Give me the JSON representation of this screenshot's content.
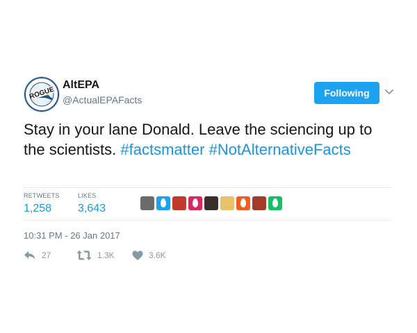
{
  "user": {
    "name": "AltEPA",
    "handle": "@ActualEPAFacts",
    "avatar_icon": "rogue-epa-logo"
  },
  "follow_button": {
    "label": "Following"
  },
  "menu_icon": "chevron-down-icon",
  "tweet": {
    "text_plain": "Stay in your lane Donald. Leave the sciencing up to the scientists.",
    "hashtags": [
      "#factsmatter",
      "#NotAlternativeFacts"
    ]
  },
  "stats": {
    "retweets_label": "RETWEETS",
    "retweets_value": "1,258",
    "likes_label": "LIKES",
    "likes_value": "3,643"
  },
  "likers": [
    {
      "type": "photo",
      "color": "#6b6b6b"
    },
    {
      "type": "egg",
      "color": "#1da1f2"
    },
    {
      "type": "photo",
      "color": "#c0392b"
    },
    {
      "type": "egg",
      "color": "#e0245e"
    },
    {
      "type": "photo",
      "color": "#3a2f2a"
    },
    {
      "type": "photo",
      "color": "#e8c26a"
    },
    {
      "type": "egg",
      "color": "#f45d22"
    },
    {
      "type": "photo",
      "color": "#a33b2b"
    },
    {
      "type": "egg",
      "color": "#17bf63"
    }
  ],
  "timestamp": "10:31 PM - 26 Jan 2017",
  "actions": {
    "reply_count": "27",
    "retweet_count": "1.3K",
    "like_count": "3.6K"
  },
  "colors": {
    "accent": "#1da1f2",
    "link": "#1b95e0",
    "muted": "#657786"
  }
}
